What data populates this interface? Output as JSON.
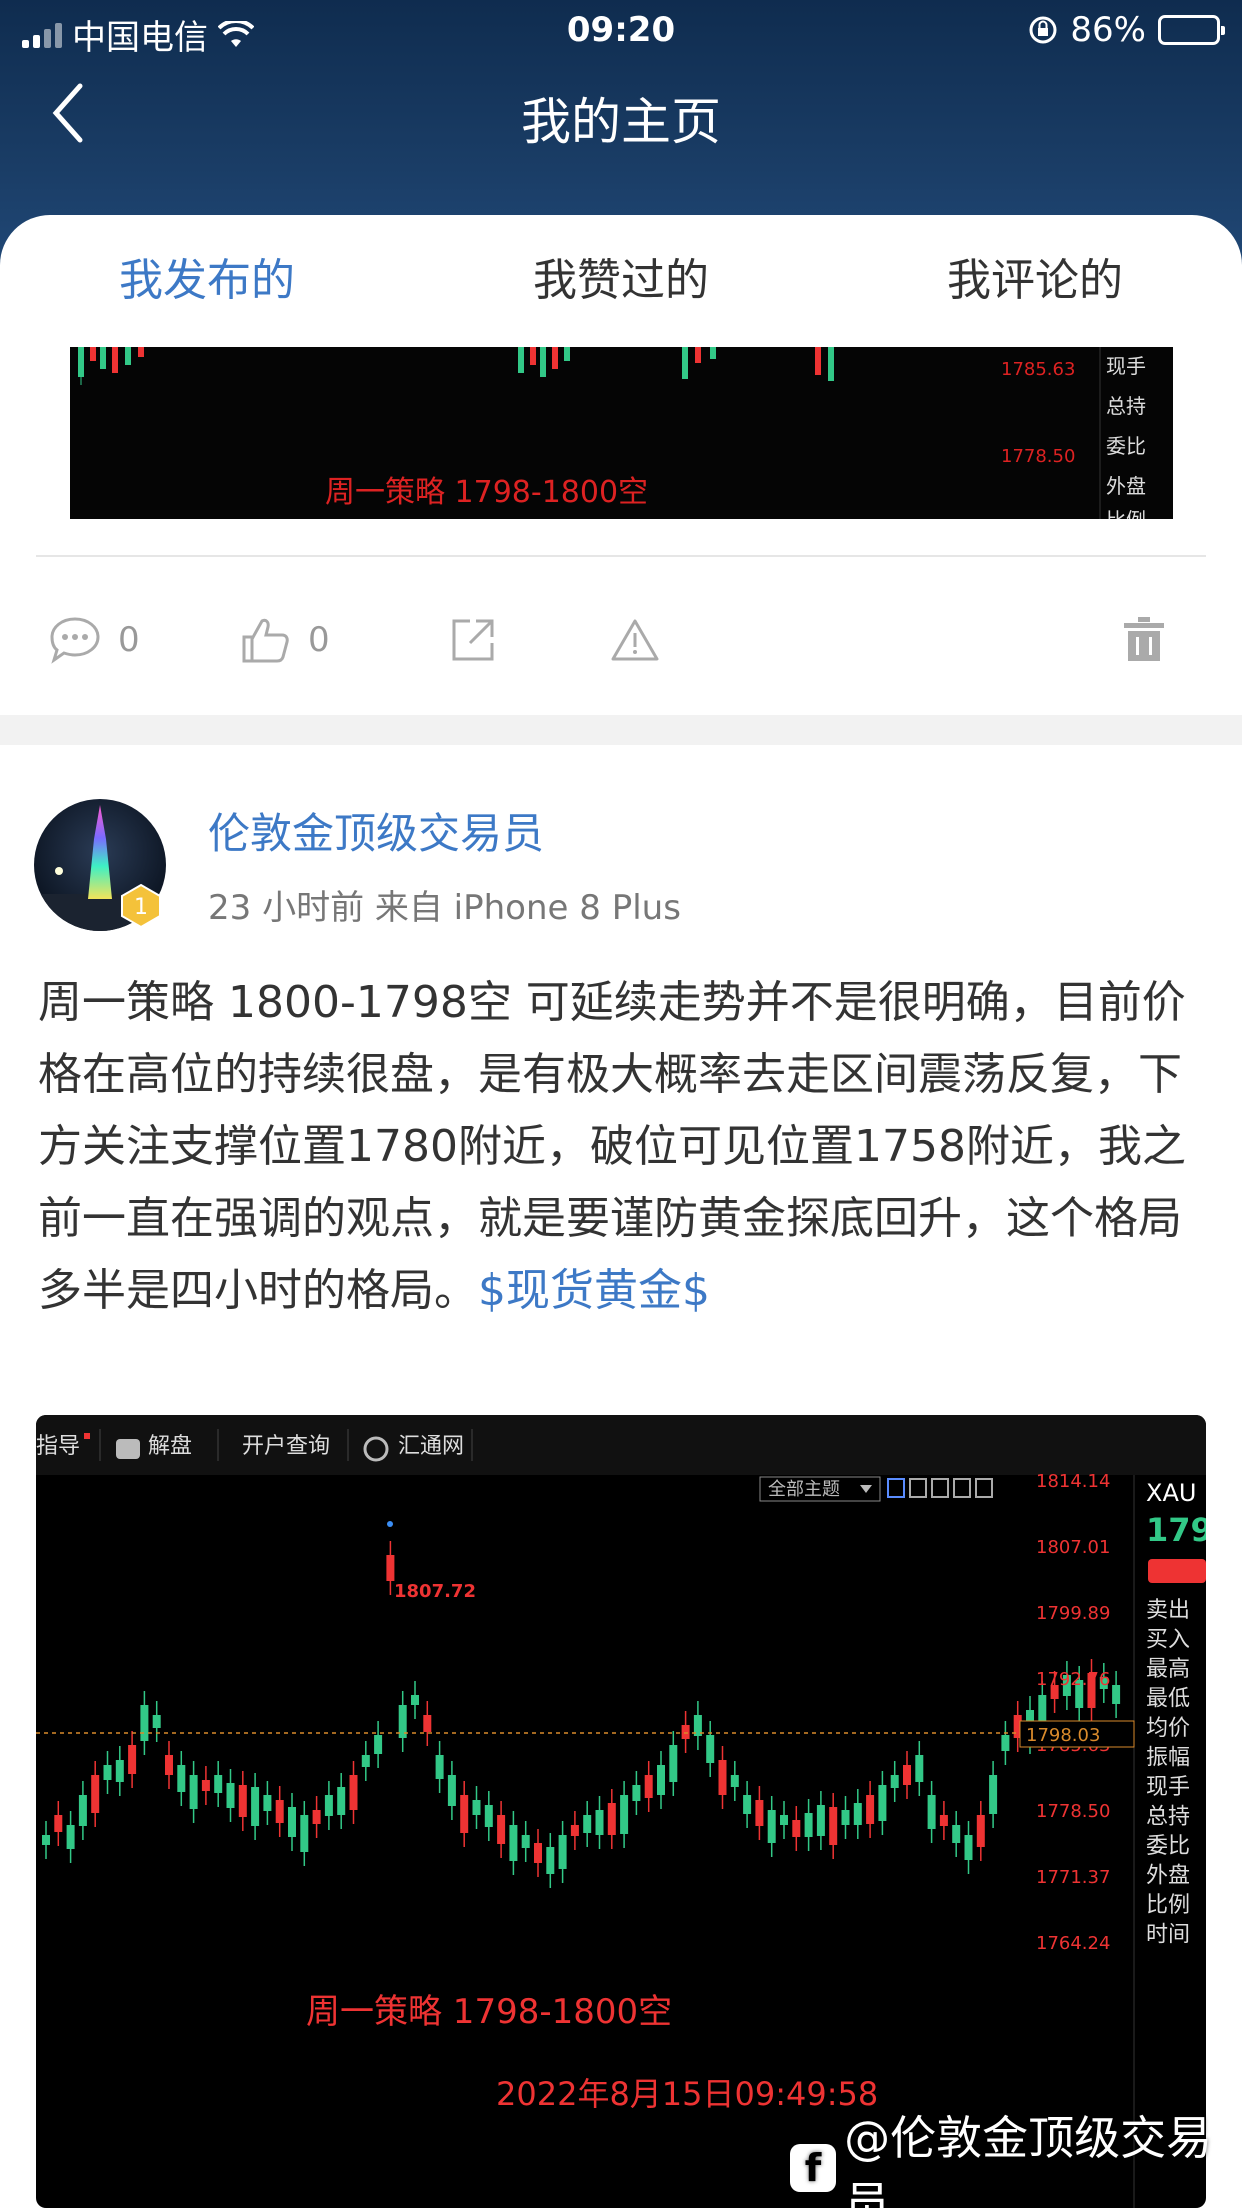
{
  "status_bar": {
    "carrier": "中国电信",
    "time": "09:20",
    "battery": "86%"
  },
  "header": {
    "title": "我的主页"
  },
  "tabs": [
    {
      "label": "我发布的",
      "active": true
    },
    {
      "label": "我赞过的"
    },
    {
      "label": "我评论的"
    }
  ],
  "post1": {
    "chart": {
      "prices": [
        "1785.63",
        "1778.50"
      ],
      "side_labels": [
        "现手",
        "总持",
        "委比",
        "外盘",
        "比例"
      ],
      "caption": "周一策略 1798-1800空"
    },
    "comment_count": "0",
    "like_count": "0"
  },
  "post2": {
    "author": "伦敦金顶级交易员",
    "meta": "23 小时前  来自 iPhone 8 Plus",
    "level": "1",
    "text": "周一策略  1800-1798空   可延续走势并不是很明确，目前价格在高位的持续很盘，是有极大概率去走区间震荡反复，下方关注支撑位置1780附近，破位可见位置1758附近，我之前一直在强调的观点，就是要谨防黄金探底回升，这个格局多半是四小时的格局。",
    "tag": "$现货黄金$",
    "chart": {
      "toolbar": [
        "指导",
        "解盘",
        "开户查询",
        "汇通网"
      ],
      "theme_select": "全部主题",
      "symbol": "XAU",
      "symbol_price": "179",
      "high_label": "1807.72",
      "current_price": "1798.03",
      "prices": [
        "1814.14",
        "1807.01",
        "1799.89",
        "1792.76",
        "1785.63",
        "1778.50",
        "1771.37",
        "1764.24"
      ],
      "side_labels": [
        "卖出",
        "买入",
        "最高",
        "最低",
        "均价",
        "振幅",
        "现手",
        "总持",
        "委比",
        "外盘",
        "比例",
        "时间"
      ],
      "caption": "周一策略 1798-1800空",
      "datetime": "2022年8月15日09:49:58"
    }
  },
  "watermark": "@伦敦金顶级交易员"
}
